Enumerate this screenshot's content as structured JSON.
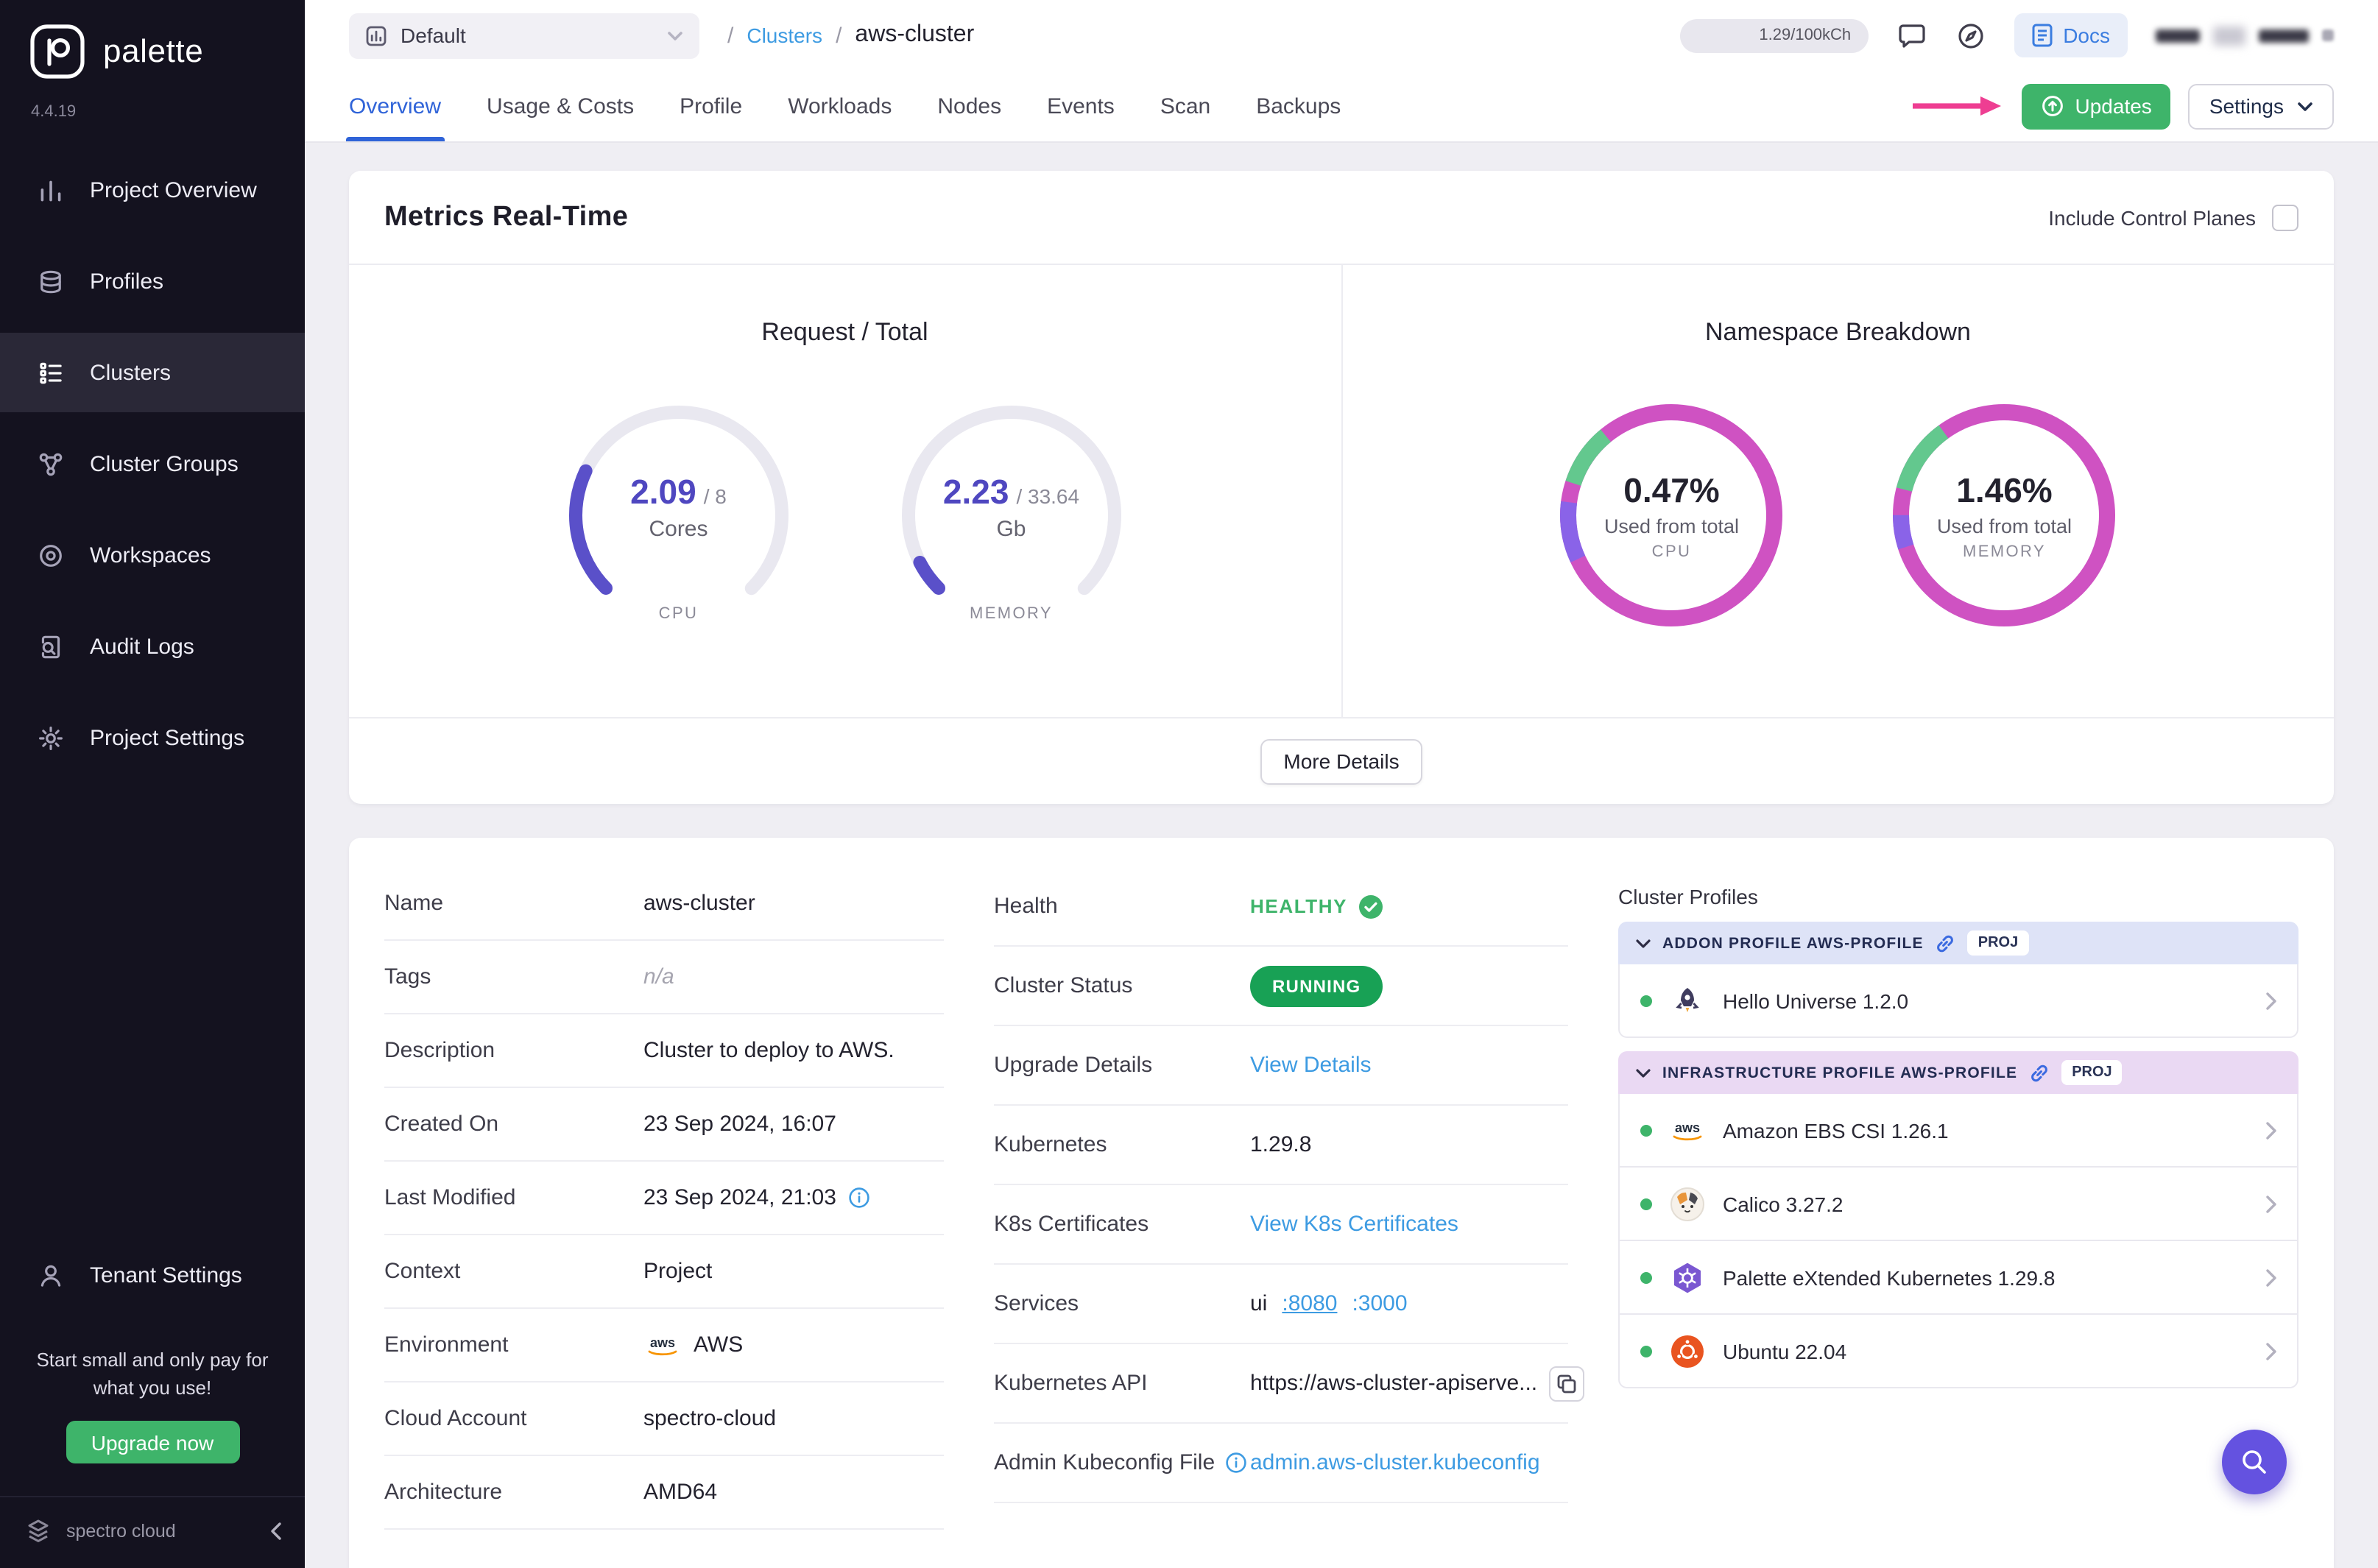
{
  "colors": {
    "sidebar_bg": "#14121f",
    "accent_green": "#3eb46a",
    "status_green": "#18a155",
    "link_blue": "#3d9be2",
    "active_tab_blue": "#2f63d8",
    "gauge_indigo": "#5a50c9",
    "donut_pink": "#cf52c2",
    "donut_purple": "#8a63e8",
    "donut_green": "#63c88e",
    "arrow_pink": "#ee3e92",
    "fab_purple": "#6452e0"
  },
  "sidebar": {
    "brand": "palette",
    "version": "4.4.19",
    "items": [
      {
        "label": "Project Overview"
      },
      {
        "label": "Profiles"
      },
      {
        "label": "Clusters"
      },
      {
        "label": "Cluster Groups"
      },
      {
        "label": "Workspaces"
      },
      {
        "label": "Audit Logs"
      },
      {
        "label": "Project Settings"
      }
    ],
    "tenant_settings": "Tenant Settings",
    "promo": "Start small and only pay for what you use!",
    "upgrade_button": "Upgrade now",
    "footer_brand": "spectro cloud"
  },
  "topbar": {
    "project_selector": "Default",
    "breadcrumb_sep": "/",
    "breadcrumb_root": "Clusters",
    "breadcrumb_current": "aws-cluster",
    "usage_pill": "1.29/100kCh",
    "docs_label": "Docs"
  },
  "tabs": {
    "items": [
      "Overview",
      "Usage & Costs",
      "Profile",
      "Workloads",
      "Nodes",
      "Events",
      "Scan",
      "Backups"
    ],
    "active": "Overview",
    "updates_button": "Updates",
    "settings_button": "Settings"
  },
  "metrics": {
    "title": "Metrics Real-Time",
    "include_control_planes": "Include Control Planes",
    "request_total_title": "Request / Total",
    "namespace_title": "Namespace Breakdown",
    "more_details": "More Details",
    "cpu_gauge": {
      "used": "2.09",
      "total": "/ 8",
      "unit": "Cores",
      "label": "CPU",
      "fraction": 0.261
    },
    "memory_gauge": {
      "used": "2.23",
      "total": "/ 33.64",
      "unit": "Gb",
      "label": "MEMORY",
      "fraction": 0.066
    },
    "cpu_donut": {
      "pct": "0.47%",
      "caption": "Used from total",
      "label": "CPU",
      "segments": [
        {
          "color": "#8a63e8",
          "offset": 0.68,
          "frac": 0.09
        },
        {
          "color": "#63c88e",
          "offset": 0.8,
          "frac": 0.09
        }
      ]
    },
    "memory_donut": {
      "pct": "1.46%",
      "caption": "Used from total",
      "label": "MEMORY",
      "segments": [
        {
          "color": "#8a63e8",
          "offset": 0.7,
          "frac": 0.05
        },
        {
          "color": "#63c88e",
          "offset": 0.79,
          "frac": 0.11
        }
      ]
    }
  },
  "overview": {
    "rows_left": [
      {
        "label": "Name",
        "value": "aws-cluster"
      },
      {
        "label": "Tags",
        "value": "n/a"
      },
      {
        "label": "Description",
        "value": "Cluster to deploy to AWS."
      },
      {
        "label": "Created On",
        "value": "23 Sep 2024, 16:07"
      },
      {
        "label": "Last Modified",
        "value": "23 Sep 2024, 21:03"
      },
      {
        "label": "Context",
        "value": "Project"
      },
      {
        "label": "Environment",
        "value": "AWS"
      },
      {
        "label": "Cloud Account",
        "value": "spectro-cloud"
      },
      {
        "label": "Architecture",
        "value": "AMD64"
      }
    ],
    "health_label": "Health",
    "health_value": "HEALTHY",
    "status_label": "Cluster Status",
    "status_value": "RUNNING",
    "upgrade_label": "Upgrade Details",
    "upgrade_link": "View Details",
    "kubernetes_label": "Kubernetes",
    "kubernetes_value": "1.29.8",
    "certs_label": "K8s Certificates",
    "certs_link": "View K8s Certificates",
    "services_label": "Services",
    "services_name": "ui",
    "services_port1": ":8080",
    "services_port2": ":3000",
    "api_label": "Kubernetes API",
    "api_value": "https://aws-cluster-apiserve...",
    "kubeconfig_label": "Admin Kubeconfig File",
    "kubeconfig_link": "admin.aws-cluster.kubeconfig"
  },
  "profiles_panel": {
    "title": "Cluster Profiles",
    "addon_header": "ADDON PROFILE AWS-PROFILE",
    "addon_badge": "PROJ",
    "addon_items": [
      {
        "name": "Hello Universe 1.2.0"
      }
    ],
    "infra_header": "INFRASTRUCTURE PROFILE AWS-PROFILE",
    "infra_badge": "PROJ",
    "infra_items": [
      {
        "name": "Amazon EBS CSI 1.26.1"
      },
      {
        "name": "Calico 3.27.2"
      },
      {
        "name": "Palette eXtended Kubernetes 1.29.8"
      },
      {
        "name": "Ubuntu 22.04"
      }
    ]
  }
}
